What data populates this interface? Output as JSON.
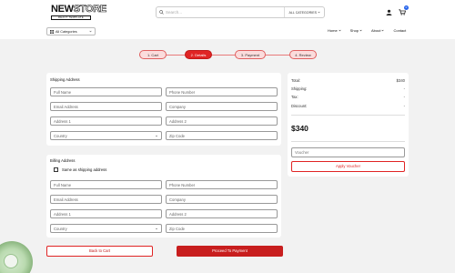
{
  "logo": {
    "brand_prefix": "NEW",
    "brand_suffix": "STORE",
    "subtitle": "REACT TEMPLATE"
  },
  "search": {
    "placeholder": "Search...",
    "category": "ALL CATEGORIES"
  },
  "cart": {
    "badge_count": "0"
  },
  "all_categories": "All Categories",
  "nav": {
    "home": "Home",
    "shop": "Shop",
    "about": "About",
    "contact": "Contact"
  },
  "steps": [
    "1. Cart",
    "2. Details",
    "3. Payment",
    "4. Review"
  ],
  "shipping": {
    "title": "Shipping Address",
    "full_name": "Full Name",
    "phone": "Phone Number",
    "email": "Email Address",
    "company": "Company",
    "address1": "Address 1",
    "address2": "Address 2",
    "country": "Country",
    "zip": "Zip Code"
  },
  "billing": {
    "title": "Billing Address",
    "same_as_shipping": "Same as shipping address",
    "full_name": "Full Name",
    "phone": "Phone Number",
    "email": "Email Address",
    "company": "Company",
    "address1": "Address 1",
    "address2": "Address 2",
    "country": "Country",
    "zip": "Zip Code"
  },
  "summary": {
    "total_label": "Total:",
    "total_value": "$340",
    "shipping_label": "Shipping:",
    "shipping_value": "-",
    "tax_label": "Tax:",
    "tax_value": "-",
    "discount_label": "Discount:",
    "discount_value": "-",
    "grand_total": "$340",
    "voucher_placeholder": "Voucher",
    "apply_voucher": "Apply Voucher"
  },
  "actions": {
    "back": "Back to Cart",
    "proceed": "Proceed To Payment"
  },
  "colors": {
    "accent": "#e02424",
    "step_inactive_bg": "#fbdcdc",
    "badge": "#2563eb",
    "page_bg": "#f2f2f2"
  }
}
